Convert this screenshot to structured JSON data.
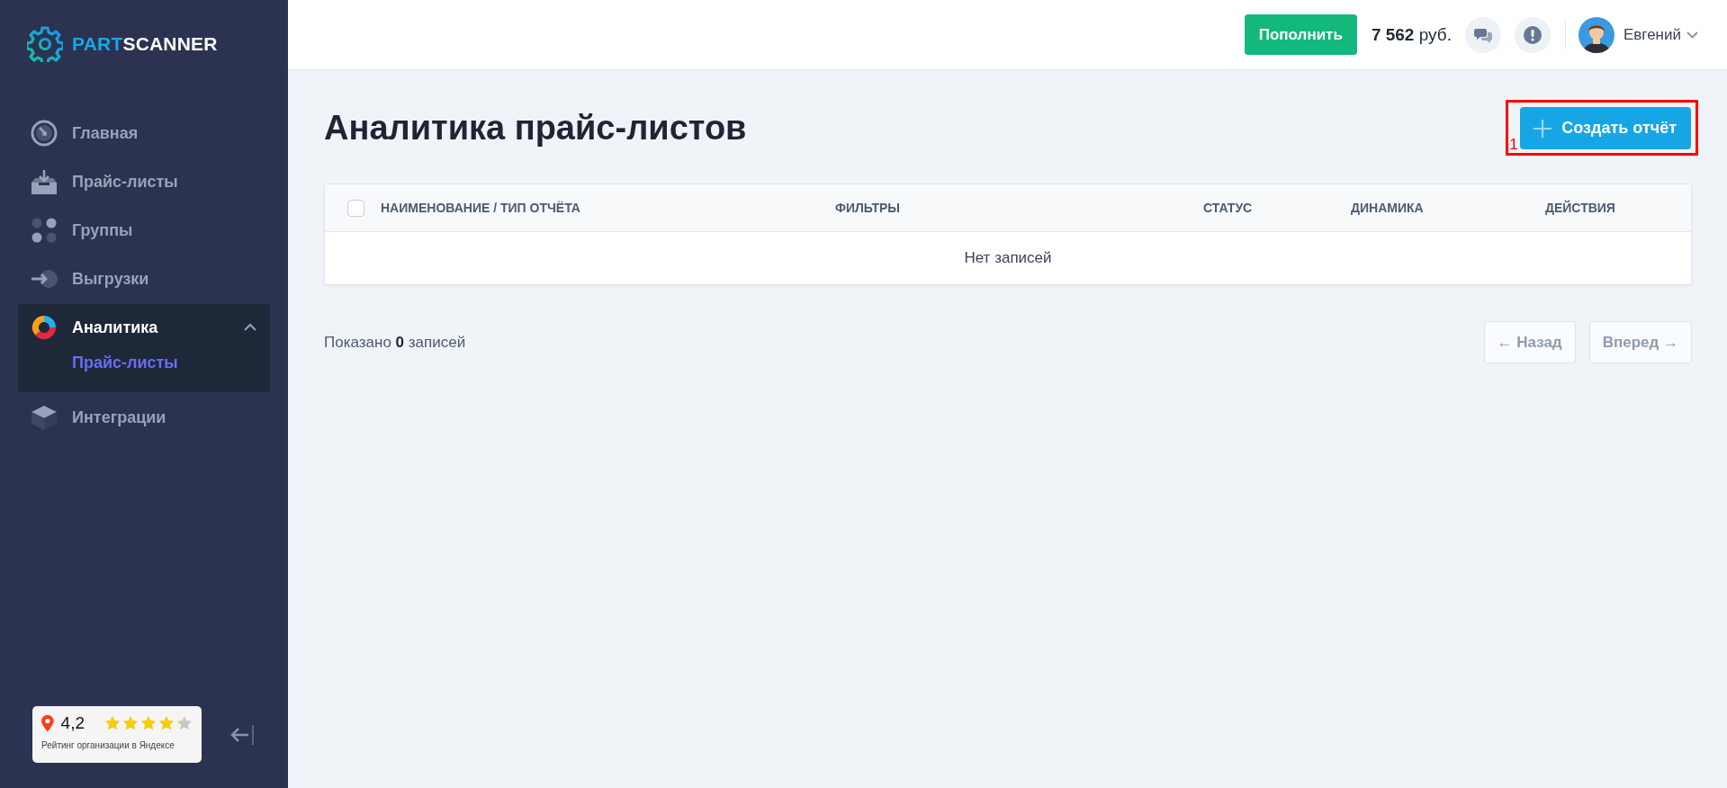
{
  "sidebar": {
    "logo": {
      "part1": "PART",
      "part2": "SCANNER"
    },
    "items": [
      {
        "kind": "gauge",
        "label": "Главная",
        "selected": false,
        "expanded": false
      },
      {
        "kind": "inbox",
        "label": "Прайс-листы",
        "selected": false,
        "expanded": false
      },
      {
        "kind": "dots",
        "label": "Группы",
        "selected": false,
        "expanded": false
      },
      {
        "kind": "export",
        "label": "Выгрузки",
        "selected": false,
        "expanded": false
      },
      {
        "kind": "donut",
        "label": "Аналитика",
        "selected": true,
        "expanded": true,
        "children": [
          {
            "label": "Прайс-листы",
            "selected": true
          }
        ]
      },
      {
        "kind": "cube",
        "label": "Интеграции",
        "selected": false,
        "expanded": false
      }
    ],
    "rating": {
      "score": "4,2",
      "stars": 4.2,
      "caption": "Рейтинг организации в Яндексе"
    }
  },
  "header": {
    "topup_button": "Пополнить",
    "balance_amount": "7 562",
    "balance_currency": "руб.",
    "user_name": "Евгений"
  },
  "page": {
    "title": "Аналитика прайс-листов",
    "create_button": "Создать отчёт",
    "annotation": {
      "label": "1"
    }
  },
  "table": {
    "select_all": {
      "checked": false
    },
    "columns": [
      "НАИМЕНОВАНИЕ / ТИП ОТЧЁТА",
      "ФИЛЬТРЫ",
      "СТАТУС",
      "ДИНАМИКА",
      "ДЕЙСТВИЯ"
    ],
    "empty_message": "Нет записей"
  },
  "footer": {
    "shown_prefix": "Показано",
    "shown_count": "0",
    "shown_suffix": "записей",
    "buttons": [
      {
        "label": "← Назад",
        "disabled": true
      },
      {
        "label": "Вперед →",
        "disabled": true
      }
    ]
  }
}
